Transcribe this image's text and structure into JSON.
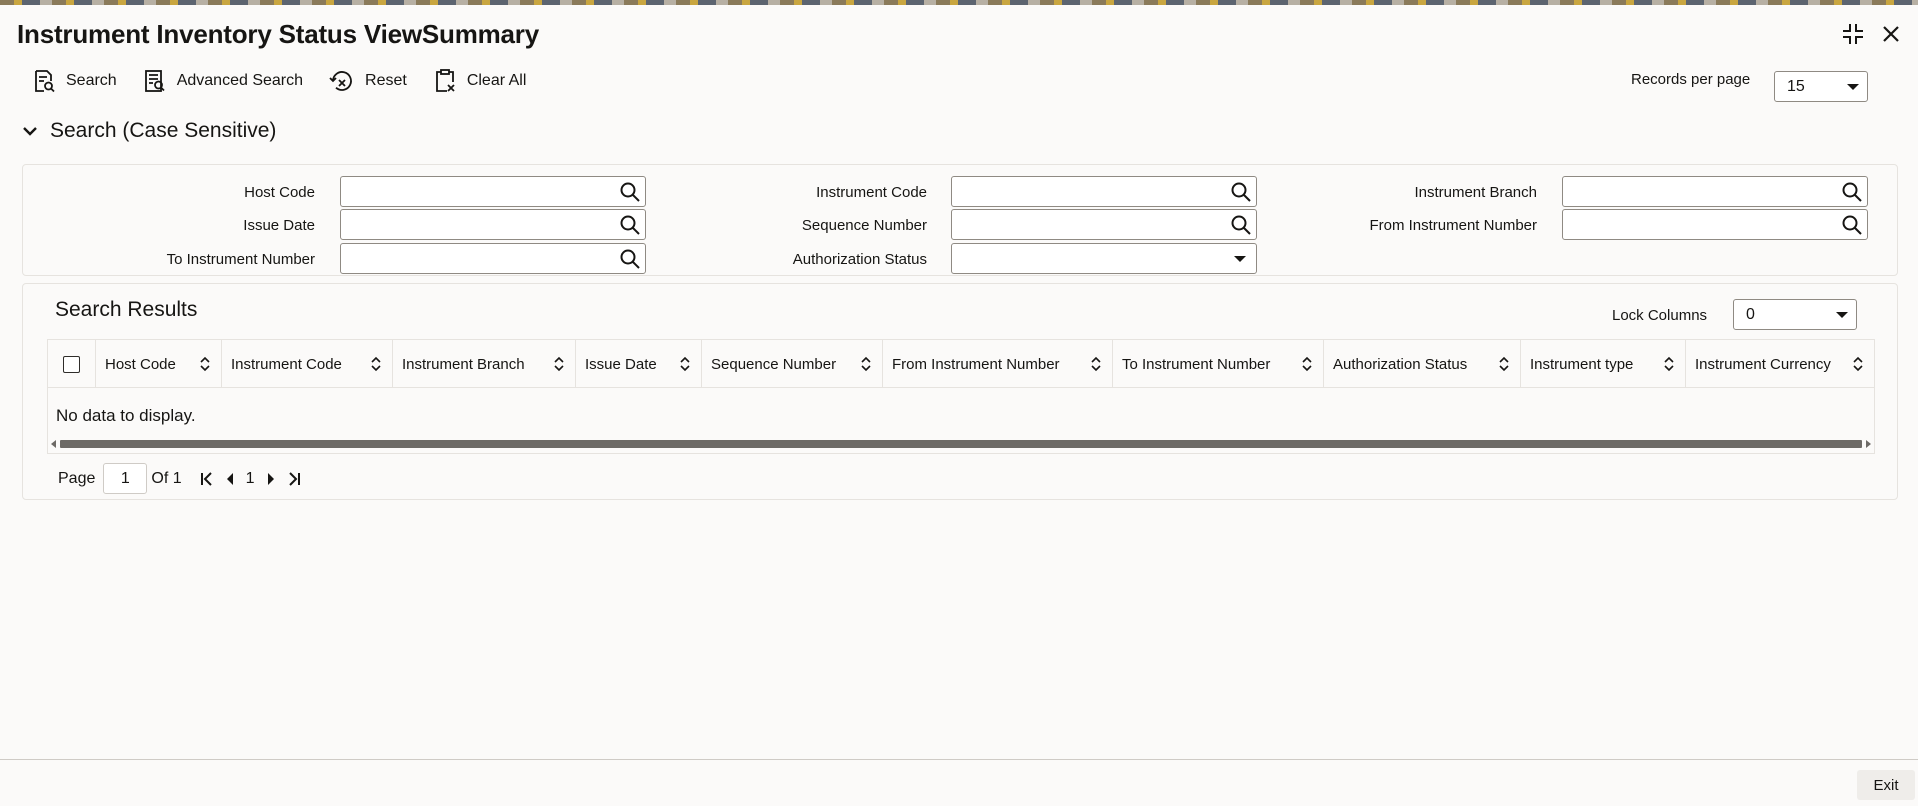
{
  "window": {
    "title": "Instrument Inventory Status ViewSummary"
  },
  "toolbar": {
    "search_label": "Search",
    "advanced_search_label": "Advanced Search",
    "reset_label": "Reset",
    "clear_all_label": "Clear All"
  },
  "records_per_page": {
    "label": "Records per page",
    "value": "15"
  },
  "search_section": {
    "title": "Search (Case Sensitive)",
    "fields": {
      "host_code": {
        "label": "Host Code",
        "value": ""
      },
      "issue_date": {
        "label": "Issue Date",
        "value": ""
      },
      "to_instrument_number": {
        "label": "To Instrument Number",
        "value": ""
      },
      "instrument_code": {
        "label": "Instrument Code",
        "value": ""
      },
      "sequence_number": {
        "label": "Sequence Number",
        "value": ""
      },
      "authorization_status": {
        "label": "Authorization Status",
        "value": ""
      },
      "instrument_branch": {
        "label": "Instrument Branch",
        "value": ""
      },
      "from_instrument_number": {
        "label": "From Instrument Number",
        "value": ""
      }
    }
  },
  "results": {
    "title": "Search Results",
    "lock_columns_label": "Lock Columns",
    "lock_columns_value": "0",
    "columns": [
      "Host Code",
      "Instrument Code",
      "Instrument Branch",
      "Issue Date",
      "Sequence Number",
      "From Instrument Number",
      "To Instrument Number",
      "Authorization Status",
      "Instrument type",
      "Instrument Currency"
    ],
    "empty_message": "No data to display."
  },
  "pagination": {
    "page_label": "Page",
    "current_page": "1",
    "of_label": "Of 1",
    "page_number": "1"
  },
  "footer": {
    "exit_label": "Exit"
  },
  "icons": {
    "maximize": "maximize-icon",
    "close": "close-icon",
    "search": "search-icon",
    "sort": "sort-icon"
  }
}
